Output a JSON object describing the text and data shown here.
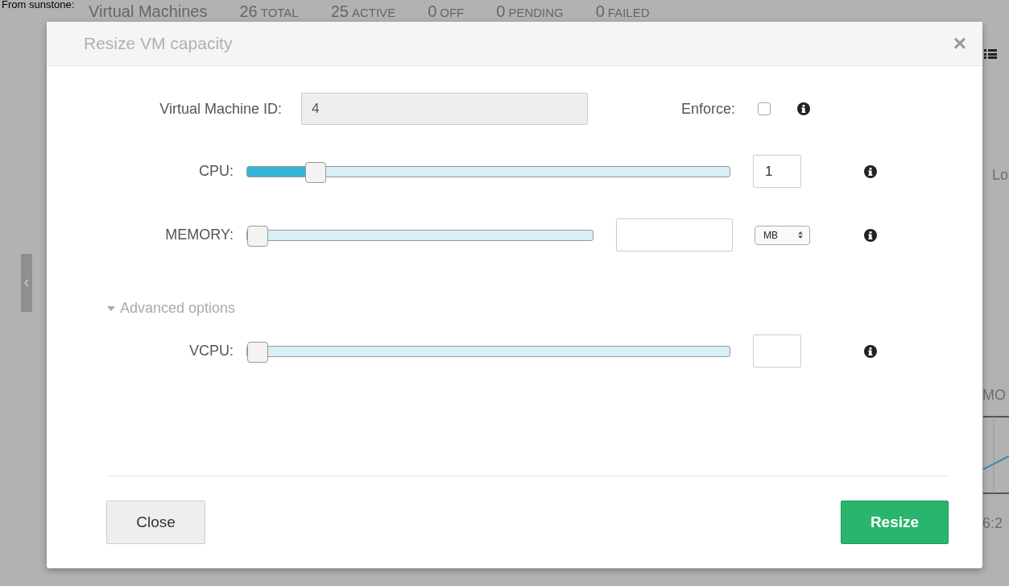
{
  "background": {
    "caption": "From sunstone:",
    "page_title": "Virtual Machines",
    "stats": [
      {
        "count": "26",
        "label": "TOTAL"
      },
      {
        "count": "25",
        "label": "ACTIVE"
      },
      {
        "count": "0",
        "label": "OFF"
      },
      {
        "count": "0",
        "label": "PENDING"
      },
      {
        "count": "0",
        "label": "FAILED"
      }
    ],
    "fragments": [
      "Lo",
      "MO",
      "6:2"
    ]
  },
  "modal": {
    "title": "Resize VM capacity",
    "close": "×",
    "vm_id": {
      "label": "Virtual Machine ID:",
      "value": "4",
      "disabled": true
    },
    "enforce": {
      "label": "Enforce:",
      "checked": false
    },
    "cpu": {
      "label": "CPU:",
      "level": 0.125,
      "value": "1"
    },
    "memory": {
      "label": "MEMORY:",
      "level": 0,
      "unit": "MB"
    },
    "advanced": {
      "label": "Advanced options",
      "expanded": true
    },
    "vcpu": {
      "label": "VCPU:",
      "level": 0
    },
    "buttons": [
      {
        "label": "Close",
        "kind": "secondary"
      },
      {
        "label": "Resize",
        "kind": "primary"
      }
    ]
  }
}
